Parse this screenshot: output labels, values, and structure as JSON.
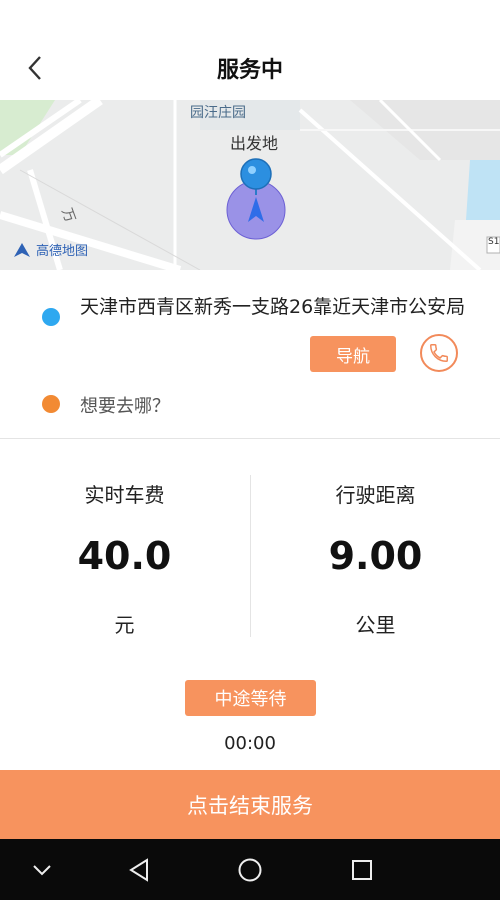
{
  "header": {
    "title": "服务中",
    "back_icon": "chevron-left-icon"
  },
  "map": {
    "poi_label": "园汪庄园",
    "origin_marker_label": "出发地",
    "road_label": "万",
    "provider_label": "高德地图",
    "edge_label": "S1"
  },
  "route": {
    "origin": "天津市西青区新秀一支路26靠近天津市公安局",
    "destination_placeholder": "想要去哪？",
    "navigate_label": "导航",
    "origin_dot_color": "#2ea8f0",
    "dest_dot_color": "#f28a33"
  },
  "stats": {
    "fare": {
      "label": "实时车费",
      "value": "40.0",
      "unit": "元"
    },
    "distance": {
      "label": "行驶距离",
      "value": "9.00",
      "unit": "公里"
    }
  },
  "wait": {
    "label": "中途等待",
    "timer": "00:00"
  },
  "end_button": {
    "label": "点击结束服务"
  },
  "colors": {
    "accent": "#f7935e",
    "system_bar": "#0a0a0a"
  }
}
